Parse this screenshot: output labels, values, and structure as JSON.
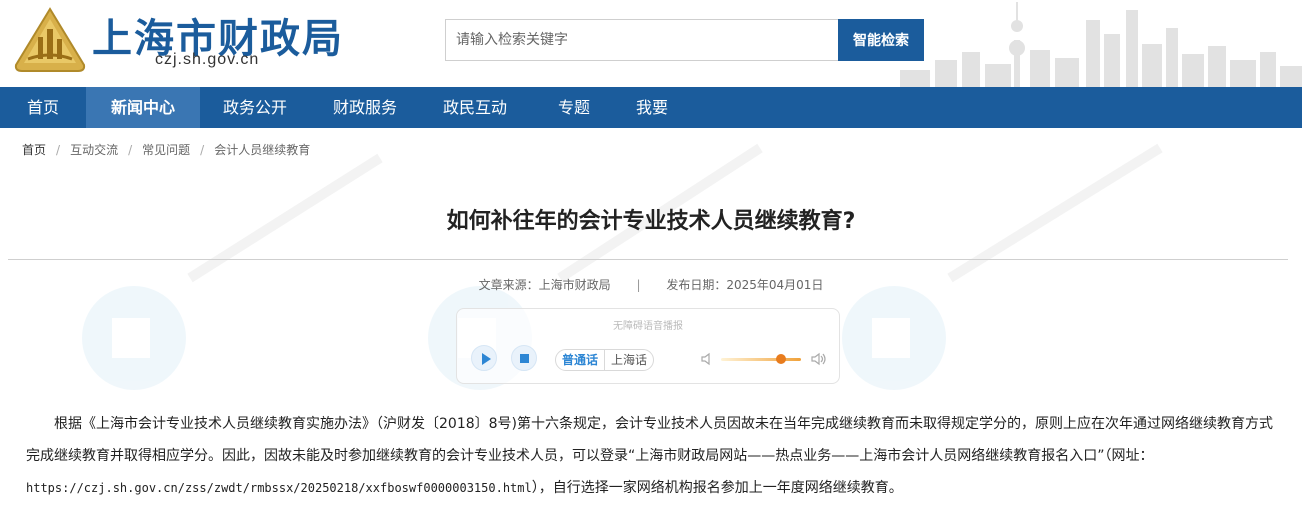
{
  "header": {
    "title": "上海市财政局",
    "domain": "czj.sh.gov.cn",
    "search_placeholder": "请输入检索关键字",
    "search_button": "智能检索"
  },
  "nav": {
    "items": [
      {
        "label": "首页",
        "active": false
      },
      {
        "label": "新闻中心",
        "active": true
      },
      {
        "label": "政务公开",
        "active": false
      },
      {
        "label": "财政服务",
        "active": false
      },
      {
        "label": "政民互动",
        "active": false
      },
      {
        "label": "专题",
        "active": false
      },
      {
        "label": "我要",
        "active": false
      }
    ]
  },
  "breadcrumb": [
    "首页",
    "互动交流",
    "常见问题",
    "会计人员继续教育"
  ],
  "article": {
    "title": "如何补往年的会计专业技术人员继续教育?",
    "source_label": "文章来源：上海市财政局",
    "date_label": "发布日期：2025年04月01日",
    "divider": "|",
    "body_part1": "根据《上海市会计专业技术人员继续教育实施办法》（沪财发〔2018〕8号)第十六条规定，会计专业技术人员因故未在当年完成继续教育而未取得规定学分的，原则上应在次年通过网络继续教育方式完成继续教育并取得相应学分。因此，因故未能及时参加继续教育的会计专业技术人员，可以登录“上海市财政局网站——热点业务——上海市会计人员网络继续教育报名入口”（网址：",
    "body_url": "https://czj.sh.gov.cn/zss/zwdt/rmbssx/20250218/xxfboswf0000003150.html",
    "body_part2": "），自行选择一家网络机构报名参加上一年度网络继续教育。"
  },
  "player": {
    "caption": "无障碍语音播报",
    "lang_mandarin": "普通话",
    "lang_shanghai": "上海话",
    "volume": 0.75
  },
  "colors": {
    "brand_blue": "#1b5c9c",
    "nav_active": "#3a76b3",
    "accent_orange": "#e87c1e"
  }
}
